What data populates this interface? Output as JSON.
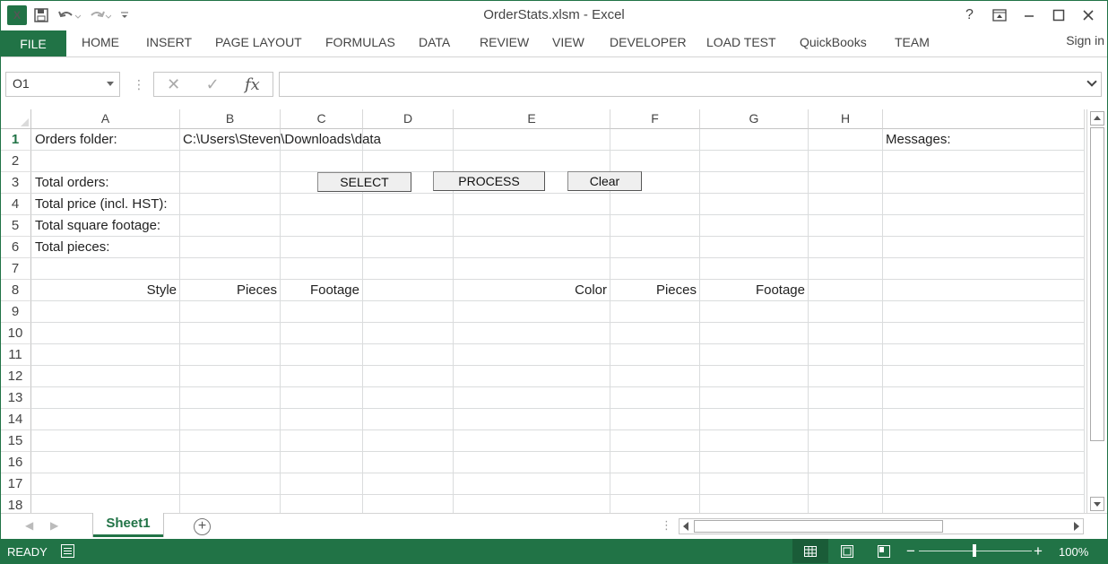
{
  "window": {
    "title": "OrderStats.xlsm - Excel",
    "help": "?",
    "app_icon": "excel-icon",
    "colors": {
      "accent": "#217346",
      "status_bg": "#217346"
    }
  },
  "ribbon": {
    "file": "FILE",
    "tabs": [
      "HOME",
      "INSERT",
      "PAGE LAYOUT",
      "FORMULAS",
      "DATA",
      "REVIEW",
      "VIEW",
      "DEVELOPER",
      "LOAD TEST",
      "QuickBooks",
      "TEAM"
    ],
    "signin": "Sign in"
  },
  "formula_bar": {
    "name_box": "O1",
    "fx_label": "fx",
    "formula": ""
  },
  "grid": {
    "columns": [
      "A",
      "B",
      "C",
      "D",
      "E",
      "F",
      "G",
      "H"
    ],
    "rows": [
      "1",
      "2",
      "3",
      "4",
      "5",
      "6",
      "7",
      "8",
      "9",
      "10",
      "11",
      "12",
      "13",
      "14",
      "15",
      "16",
      "17",
      "18"
    ],
    "cells": {
      "A1": "Orders folder:",
      "B1": "C:\\Users\\Steven\\Downloads\\data",
      "I1": "Messages:",
      "A3": "Total orders:",
      "A4": "Total price (incl. HST):",
      "A5": "Total square footage:",
      "A6": "Total pieces:",
      "A8": "Style",
      "B8": "Pieces",
      "C8": "Footage",
      "E8": "Color",
      "F8": "Pieces",
      "G8": "Footage"
    },
    "buttons": {
      "select": "SELECT",
      "process": "PROCESS",
      "clear": "Clear"
    }
  },
  "sheets": {
    "active": "Sheet1",
    "add": "+"
  },
  "status": {
    "ready": "READY",
    "zoom": "100%",
    "zoom_minus": "−",
    "zoom_plus": "+"
  }
}
